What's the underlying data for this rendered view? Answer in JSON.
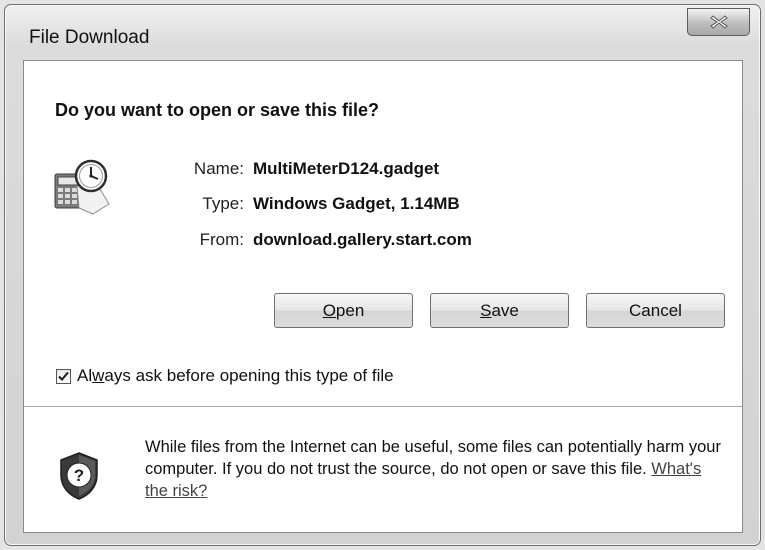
{
  "window": {
    "title": "File Download",
    "close_icon": "close-icon"
  },
  "dialog": {
    "heading": "Do you want to open or save this file?",
    "file_icon": "calculator-clock-icon",
    "fields": [
      {
        "label": "Name:",
        "value": "MultiMeterD124.gadget"
      },
      {
        "label": "Type:",
        "value": "Windows Gadget, 1.14MB"
      },
      {
        "label": "From:",
        "value": "download.gallery.start.com"
      }
    ],
    "buttons": {
      "open": {
        "pre": "",
        "key": "O",
        "post": "pen"
      },
      "save": {
        "pre": "",
        "key": "S",
        "post": "ave"
      },
      "cancel": "Cancel"
    },
    "always_ask": {
      "checked": true,
      "pre": "Al",
      "key": "w",
      "post": "ays ask before opening this type of file"
    },
    "warning": {
      "icon": "shield-question-icon",
      "text": "While files from the Internet can be useful, some files can potentially harm your computer. If you do not trust the source, do not open or save this file.",
      "link": "What's the risk?"
    }
  }
}
